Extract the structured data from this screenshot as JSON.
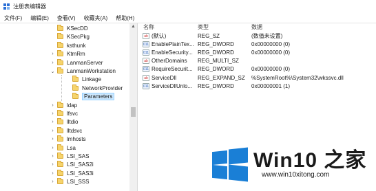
{
  "window": {
    "title": "注册表编辑器"
  },
  "menu": [
    "文件(F)",
    "编辑(E)",
    "查看(V)",
    "收藏夹(A)",
    "帮助(H)"
  ],
  "tree": [
    {
      "label": "KSecDD",
      "arrow": "",
      "selected": false
    },
    {
      "label": "KSecPkg",
      "arrow": "",
      "selected": false
    },
    {
      "label": "ksthunk",
      "arrow": "",
      "selected": false
    },
    {
      "label": "KtmRm",
      "arrow": ">",
      "selected": false
    },
    {
      "label": "LanmanServer",
      "arrow": ">",
      "selected": false
    },
    {
      "label": "LanmanWorkstation",
      "arrow": "v",
      "selected": false
    },
    {
      "label": "Linkage",
      "arrow": "",
      "selected": false
    },
    {
      "label": "NetworkProvider",
      "arrow": "",
      "selected": false
    },
    {
      "label": "Parameters",
      "arrow": "",
      "selected": true
    },
    {
      "label": "ldap",
      "arrow": ">",
      "selected": false
    },
    {
      "label": "lfsvc",
      "arrow": ">",
      "selected": false
    },
    {
      "label": "lltdio",
      "arrow": ">",
      "selected": false
    },
    {
      "label": "lltdsvc",
      "arrow": ">",
      "selected": false
    },
    {
      "label": "lmhosts",
      "arrow": ">",
      "selected": false
    },
    {
      "label": "Lsa",
      "arrow": ">",
      "selected": false
    },
    {
      "label": "LSI_SAS",
      "arrow": ">",
      "selected": false
    },
    {
      "label": "LSI_SAS2i",
      "arrow": ">",
      "selected": false
    },
    {
      "label": "LSI_SAS3i",
      "arrow": ">",
      "selected": false
    },
    {
      "label": "LSI_SSS",
      "arrow": ">",
      "selected": false
    }
  ],
  "columns": {
    "name": "名称",
    "type": "类型",
    "data": "数据"
  },
  "values": [
    {
      "icon": "ab",
      "name": "(默认)",
      "type": "REG_SZ",
      "data": "(数值未设置)"
    },
    {
      "icon": "bin",
      "name": "EnablePlainTex...",
      "type": "REG_DWORD",
      "data": "0x00000000 (0)"
    },
    {
      "icon": "bin",
      "name": "EnableSecurity...",
      "type": "REG_DWORD",
      "data": "0x00000000 (0)"
    },
    {
      "icon": "ab",
      "name": "OtherDomains",
      "type": "REG_MULTI_SZ",
      "data": ""
    },
    {
      "icon": "bin",
      "name": "RequireSecurit...",
      "type": "REG_DWORD",
      "data": "0x00000000 (0)"
    },
    {
      "icon": "ab",
      "name": "ServiceDll",
      "type": "REG_EXPAND_SZ",
      "data": "%SystemRoot%\\System32\\wkssvc.dll"
    },
    {
      "icon": "bin",
      "name": "ServiceDllUnlo...",
      "type": "REG_DWORD",
      "data": "0x00000001 (1)"
    }
  ],
  "value_icon_text": {
    "ab": "ab",
    "bin": "011"
  },
  "watermark": {
    "title": "Win10 之家",
    "url": "www.win10xitong.com"
  },
  "colors": {
    "accent": "#1a7fd6",
    "folder": "#f6d46c",
    "selection": "#cce8ff"
  }
}
